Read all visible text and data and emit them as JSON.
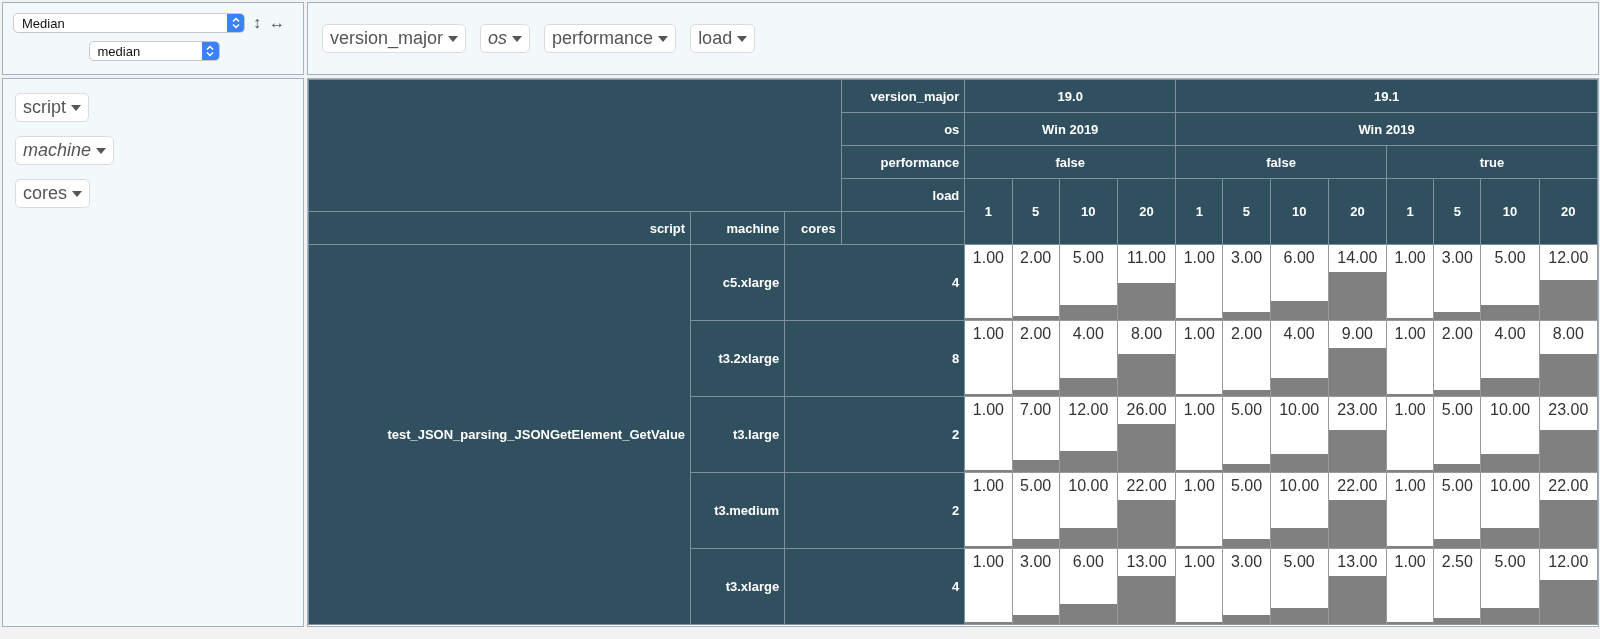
{
  "aggregator": {
    "value": "Median"
  },
  "aggregator_attribute": {
    "value": "median"
  },
  "row_order_toggle": "↕",
  "col_order_toggle": "↔",
  "col_attributes": [
    {
      "label": "version_major",
      "filtered": false
    },
    {
      "label": "os",
      "filtered": true
    },
    {
      "label": "performance",
      "filtered": false
    },
    {
      "label": "load",
      "filtered": false
    }
  ],
  "row_attributes": [
    {
      "label": "script",
      "filtered": false
    },
    {
      "label": "machine",
      "filtered": true
    },
    {
      "label": "cores",
      "filtered": false
    }
  ],
  "table": {
    "column_header_attributes": [
      "version_major",
      "os",
      "performance",
      "load"
    ],
    "column_tree": [
      {
        "label": "19.0",
        "children": [
          {
            "label": "Win 2019",
            "children": [
              {
                "label": "false",
                "children": [
                  {
                    "label": "1"
                  },
                  {
                    "label": "5"
                  },
                  {
                    "label": "10"
                  },
                  {
                    "label": "20"
                  }
                ]
              }
            ]
          }
        ]
      },
      {
        "label": "19.1",
        "children": [
          {
            "label": "Win 2019",
            "children": [
              {
                "label": "false",
                "children": [
                  {
                    "label": "1"
                  },
                  {
                    "label": "5"
                  },
                  {
                    "label": "10"
                  },
                  {
                    "label": "20"
                  }
                ]
              },
              {
                "label": "true",
                "children": [
                  {
                    "label": "1"
                  },
                  {
                    "label": "5"
                  },
                  {
                    "label": "10"
                  },
                  {
                    "label": "20"
                  }
                ]
              }
            ]
          }
        ]
      }
    ],
    "row_attribute_headers": [
      "script",
      "machine",
      "cores"
    ],
    "row_groups": [
      {
        "script": "test_JSON_parsing_JSONGetElement_GetValue",
        "rows": [
          {
            "machine": "c5.xlarge",
            "cores": "4",
            "cells": [
              {
                "value": "1.00",
                "level": 0
              },
              {
                "value": "2.00",
                "level": 0.05
              },
              {
                "value": "5.00",
                "level": 0.2
              },
              {
                "value": "11.00",
                "level": 0.49
              },
              {
                "value": "1.00",
                "level": 0
              },
              {
                "value": "3.00",
                "level": 0.1
              },
              {
                "value": "6.00",
                "level": 0.25
              },
              {
                "value": "14.00",
                "level": 0.64
              },
              {
                "value": "1.00",
                "level": 0
              },
              {
                "value": "3.00",
                "level": 0.1
              },
              {
                "value": "5.00",
                "level": 0.2
              },
              {
                "value": "12.00",
                "level": 0.54
              }
            ]
          },
          {
            "machine": "t3.2xlarge",
            "cores": "8",
            "cells": [
              {
                "value": "1.00",
                "level": 0
              },
              {
                "value": "2.00",
                "level": 0.08
              },
              {
                "value": "4.00",
                "level": 0.24
              },
              {
                "value": "8.00",
                "level": 0.56
              },
              {
                "value": "1.00",
                "level": 0
              },
              {
                "value": "2.00",
                "level": 0.08
              },
              {
                "value": "4.00",
                "level": 0.24
              },
              {
                "value": "9.00",
                "level": 0.64
              },
              {
                "value": "1.00",
                "level": 0
              },
              {
                "value": "2.00",
                "level": 0.08
              },
              {
                "value": "4.00",
                "level": 0.24
              },
              {
                "value": "8.00",
                "level": 0.56
              }
            ]
          },
          {
            "machine": "t3.large",
            "cores": "2",
            "cells": [
              {
                "value": "1.00",
                "level": 0
              },
              {
                "value": "7.00",
                "level": 0.15
              },
              {
                "value": "12.00",
                "level": 0.28
              },
              {
                "value": "26.00",
                "level": 0.64
              },
              {
                "value": "1.00",
                "level": 0
              },
              {
                "value": "5.00",
                "level": 0.1
              },
              {
                "value": "10.00",
                "level": 0.23
              },
              {
                "value": "23.00",
                "level": 0.56
              },
              {
                "value": "1.00",
                "level": 0
              },
              {
                "value": "5.00",
                "level": 0.1
              },
              {
                "value": "10.00",
                "level": 0.23
              },
              {
                "value": "23.00",
                "level": 0.56
              }
            ]
          },
          {
            "machine": "t3.medium",
            "cores": "2",
            "cells": [
              {
                "value": "1.00",
                "level": 0
              },
              {
                "value": "5.00",
                "level": 0.12
              },
              {
                "value": "10.00",
                "level": 0.27
              },
              {
                "value": "22.00",
                "level": 0.64
              },
              {
                "value": "1.00",
                "level": 0
              },
              {
                "value": "5.00",
                "level": 0.12
              },
              {
                "value": "10.00",
                "level": 0.27
              },
              {
                "value": "22.00",
                "level": 0.64
              },
              {
                "value": "1.00",
                "level": 0
              },
              {
                "value": "5.00",
                "level": 0.12
              },
              {
                "value": "10.00",
                "level": 0.27
              },
              {
                "value": "22.00",
                "level": 0.64
              }
            ]
          },
          {
            "machine": "t3.xlarge",
            "cores": "4",
            "cells": [
              {
                "value": "1.00",
                "level": 0
              },
              {
                "value": "3.00",
                "level": 0.11
              },
              {
                "value": "6.00",
                "level": 0.27
              },
              {
                "value": "13.00",
                "level": 0.64
              },
              {
                "value": "1.00",
                "level": 0
              },
              {
                "value": "3.00",
                "level": 0.11
              },
              {
                "value": "5.00",
                "level": 0.21
              },
              {
                "value": "13.00",
                "level": 0.64
              },
              {
                "value": "1.00",
                "level": 0
              },
              {
                "value": "2.50",
                "level": 0.08
              },
              {
                "value": "5.00",
                "level": 0.21
              },
              {
                "value": "12.00",
                "level": 0.59
              }
            ]
          }
        ]
      }
    ]
  }
}
